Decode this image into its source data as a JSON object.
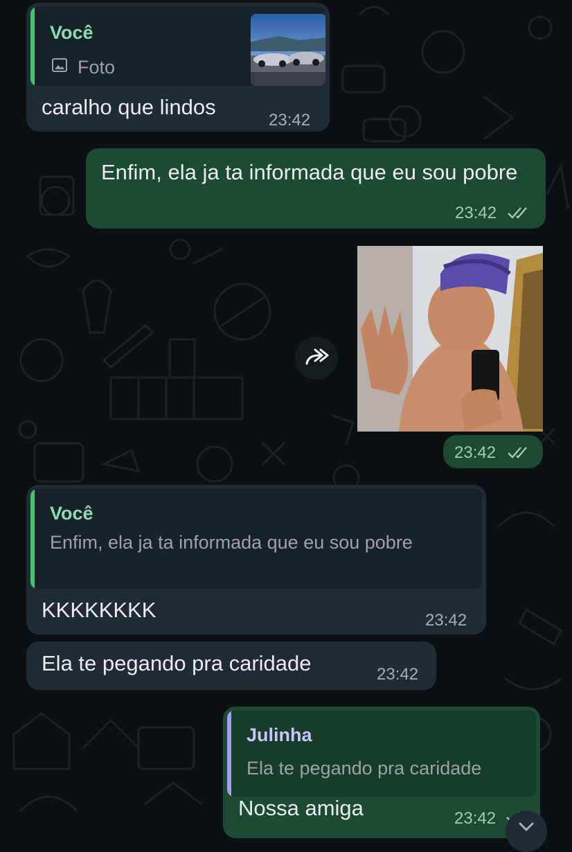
{
  "colors": {
    "background": "#0b1014",
    "incoming_bubble": "#1f2c33",
    "outgoing_bubble": "#1c4a32",
    "you_name": "#8fdbb0",
    "julinha_name": "#c9c3ff",
    "quote_bar_green": "#3fc46f",
    "quote_bar_purple": "#a79cf2"
  },
  "messages": [
    {
      "direction": "incoming",
      "quote": {
        "author": "Você",
        "type_icon": "image-icon",
        "text": "Foto",
        "thumbnail": "cars-by-sea-photo"
      },
      "text": "caralho que lindos",
      "time": "23:42"
    },
    {
      "direction": "outgoing",
      "text": "Enfim, ela ja ta informada que eu sou pobre",
      "time": "23:42",
      "status_icon": "double-check-icon"
    },
    {
      "direction": "outgoing",
      "type": "photo",
      "photo": "selfie-photo",
      "forward_icon": "forward-icon",
      "time": "23:42",
      "status_icon": "double-check-icon"
    },
    {
      "direction": "incoming",
      "quote": {
        "author": "Você",
        "text": "Enfim, ela ja ta informada que eu sou pobre"
      },
      "text": "KKKKKKKK",
      "time": "23:42"
    },
    {
      "direction": "incoming",
      "text": "Ela te pegando pra caridade",
      "time": "23:42"
    },
    {
      "direction": "outgoing",
      "quote": {
        "author": "Julinha",
        "text": "Ela te pegando pra caridade"
      },
      "text": "Nossa amiga",
      "time": "23:42",
      "status_icon": "double-check-icon"
    }
  ]
}
